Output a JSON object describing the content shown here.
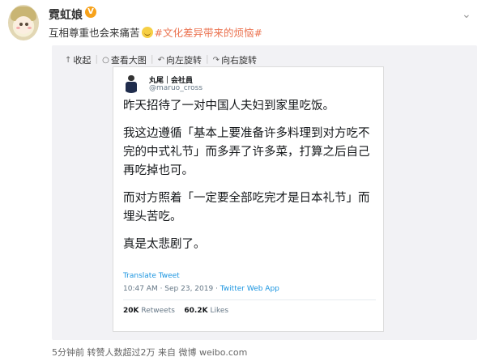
{
  "user": {
    "name": "霓虹娘",
    "badge": "V"
  },
  "post": {
    "text": "互相尊重也会来痛苦",
    "tag": "#文化差异带来的烦恼#"
  },
  "toolbar": {
    "collapse": "收起",
    "view_large": "查看大图",
    "rotate_left": "向左旋转",
    "rotate_right": "向右旋转"
  },
  "tweet": {
    "name": "丸尾｜会社員",
    "handle": "@maruo_cross",
    "para1": "昨天招待了一对中国人夫妇到家里吃饭。",
    "para2": "我这边遵循「基本上要准备许多料理到对方吃不完的中式礼节」而多弄了许多菜，打算之后自己再吃掉也可。",
    "para3": "而对方照着「一定要全部吃完才是日本礼节」而埋头苦吃。",
    "para4": "真是太悲剧了。",
    "translate": "Translate Tweet",
    "time": "10:47 AM · Sep 23, 2019 · ",
    "app": "Twitter Web App",
    "retweets_count": "20K",
    "retweets_label": " Retweets",
    "likes_count": "60.2K",
    "likes_label": " Likes"
  },
  "footer": "5分钟前 转赞人数超过2万 来自 微博 weibo.com"
}
